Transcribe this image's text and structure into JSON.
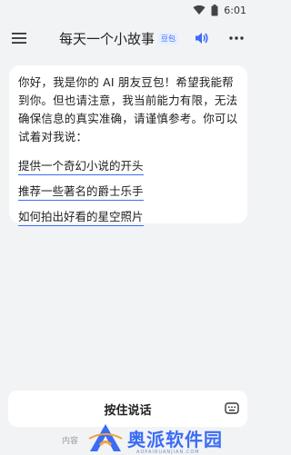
{
  "status_bar": {
    "time": "6:01",
    "icons": [
      "wifi-icon",
      "battery-icon"
    ]
  },
  "header": {
    "title": "每天一个小故事",
    "badge": "豆包",
    "icons": [
      "menu-icon",
      "speaker-icon",
      "more-icon"
    ],
    "accent_color": "#3b6cf6"
  },
  "message": {
    "greeting": "你好，我是你的 AI 朋友豆包！希望我能帮到你。但也请注意，我当前能力有限，无法确保信息的真实准确，请谨慎参考。你可以试着对我说：",
    "suggestions": [
      "提供一个奇幻小说的开头",
      "推荐一些著名的爵士乐手",
      "如何拍出好看的星空照片"
    ]
  },
  "input_bar": {
    "hold_to_talk": "按住说话",
    "icon": "keyboard-icon"
  },
  "footer": {
    "disclaimer": "内容"
  },
  "watermark": {
    "text": "奥派软件园",
    "sub": "AOPAIRUANJIAN.COM"
  }
}
